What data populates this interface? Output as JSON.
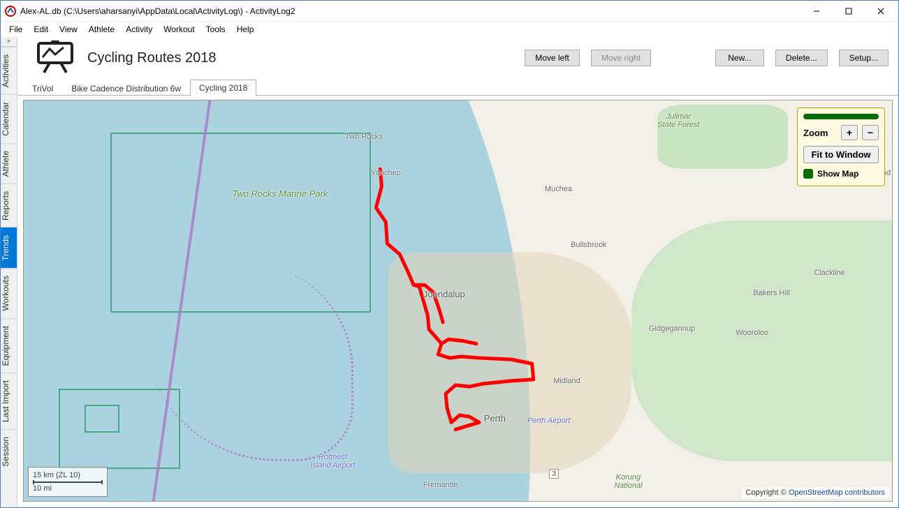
{
  "window": {
    "title": "Alex-AL.db (C:\\Users\\aharsanyi\\AppData\\Local\\ActivityLog\\) - ActivityLog2"
  },
  "menu": [
    "File",
    "Edit",
    "View",
    "Athlete",
    "Activity",
    "Workout",
    "Tools",
    "Help"
  ],
  "sidebar": {
    "toggle": "»",
    "tabs": [
      {
        "label": "Activities"
      },
      {
        "label": "Calendar"
      },
      {
        "label": "Athlete"
      },
      {
        "label": "Reports"
      },
      {
        "label": "Trends",
        "active": true
      },
      {
        "label": "Workouts"
      },
      {
        "label": "Equipment"
      },
      {
        "label": "Last Import"
      },
      {
        "label": "Session"
      }
    ]
  },
  "header": {
    "page_title": "Cycling Routes 2018",
    "buttons": {
      "move_left": "Move left",
      "move_right": "Move right",
      "new": "New...",
      "delete": "Delete...",
      "setup": "Setup..."
    }
  },
  "subtabs": [
    {
      "label": "TriVol"
    },
    {
      "label": "Bike Cadence Distribution 6w"
    },
    {
      "label": "Cycling 2018",
      "active": true
    }
  ],
  "map": {
    "labels": {
      "two_rocks": "Two Rocks",
      "yanchep": "Yanchep",
      "muchea": "Muchea",
      "bullsbrook": "Bullsbrook",
      "joondalup": "Joondalup",
      "gidgegannup": "Gidgegannup",
      "wooroloo": "Wooroloo",
      "bakers_hill": "Bakers Hill",
      "clackline": "Clackline",
      "toodyay_partial": "Tood",
      "midland": "Midland",
      "perth": "Perth",
      "perth_airport": "Perth Airport",
      "fremantle": "Fremantle",
      "rottnest_airport": "Rottnest\nIsland Airport",
      "korung_national": "Korung\nNational",
      "julimar_state_forest": "Julimar\nState Forest",
      "two_rocks_marine_park": "Two Rocks\nMarine\nPark",
      "route_3": "3"
    },
    "panel": {
      "zoom_label": "Zoom",
      "plus": "+",
      "minus": "−",
      "fit": "Fit to Window",
      "show_map": "Show Map"
    },
    "scale": {
      "km": "15 km  (ZL 10)",
      "mi": "10 mi"
    },
    "attribution": {
      "prefix": "Copyright © ",
      "link": "OpenStreetMap contributors"
    }
  }
}
